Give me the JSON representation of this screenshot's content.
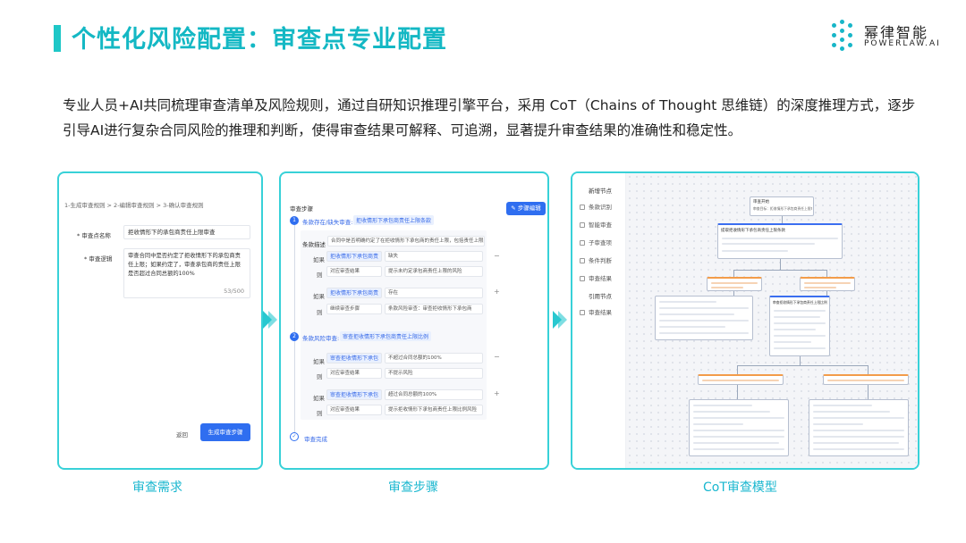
{
  "header": {
    "title": "个性化风险配置：审查点专业配置"
  },
  "logo": {
    "cn": "幂律智能",
    "en": "POWERLAW.AI",
    "color": "#17b6c8"
  },
  "intro": {
    "text": "专业人员+AI共同梳理审查清单及风险规则，通过自研知识推理引擎平台，采用 CoT（Chains of Thought 思维链）的深度推理方式，逐步引导AI进行复杂合同风险的推理和判断，使得审查结果可解释、可追溯，显著提升审查结果的准确性和稳定性。"
  },
  "captions": {
    "p1": "审查需求",
    "p2": "审查步骤",
    "p3": "CoT审查模型"
  },
  "panel1": {
    "breadcrumb": "1-生成审查规则 > 2-编辑审查规则 > 3-确认审查规则",
    "name_label": "* 审查点名称",
    "name_value": "拒收情形下的承包商责任上限审查",
    "logic_label": "* 审查逻辑",
    "logic_value": "审查合同中是否约定了拒收情形下的承包商责任上限；如果约定了，审查承包商的责任上限是否超过合同总额的100%",
    "counter": "53/500",
    "back_button": "返回",
    "generate_button": "生成审查步骤"
  },
  "panel2": {
    "title": "审查步骤",
    "edit_button": "步骤编辑",
    "step1_num": "1",
    "step1_label": "条款存在/缺失审查:",
    "step1_tag": "拒收情形下承包商责任上限条款",
    "desc_label": "条款描述",
    "desc_value": "合同中是否明确约定了在拒收情形下承包商的责任上限，包括责任上限的",
    "r1": {
      "if": "如果",
      "cond": "拒收情形下承包商责任...",
      "op": "缺失",
      "then": "则",
      "action": "对应审查结果",
      "result": "提示未约定承包商责任上限的风险"
    },
    "r2": {
      "if": "如果",
      "cond": "拒收情形下承包商责任...",
      "op": "存在",
      "then": "则",
      "action": "继续审查步骤",
      "result": "条款风险审查：审查拒收情形下承包商"
    },
    "step2_num": "2",
    "step2_label": "条款风险审查:",
    "step2_tag": "审查拒收情形下承包商责任上限比例",
    "r3": {
      "if": "如果",
      "cond": "审查拒收情形下承包商...",
      "op": "不超过合同总额的100%",
      "then": "则",
      "action": "对应审查结果",
      "result": "不提示风险"
    },
    "r4": {
      "if": "如果",
      "cond": "审查拒收情形下承包商...",
      "op": "超过合同总额的100%",
      "then": "则",
      "action": "对应审查结果",
      "result": "提示拒收情形下承包商责任上限比例风险"
    },
    "done": "审查完成"
  },
  "panel3": {
    "nav_title": "新增节点",
    "nav": [
      "条款识别",
      "智能审查",
      "子审查项",
      "条件判断",
      "审查结果"
    ],
    "ref_title": "引用节点",
    "ref_nav": [
      "审查结果"
    ],
    "root_title": "审查开始",
    "root_sub": "审查目标：拒收情形下承包商责任上限审查",
    "n1_title": "提取拒收情形下承包商责任上限条款",
    "n2_title": "审查拒收情形下承包商责任上限比例"
  }
}
